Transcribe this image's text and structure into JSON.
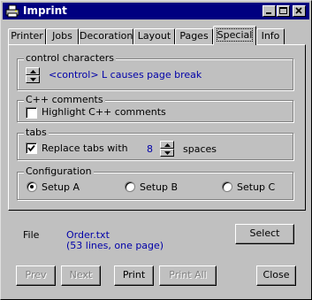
{
  "window": {
    "title": "Imprint",
    "controls": [
      "minimize",
      "maximize",
      "close"
    ]
  },
  "tabs": [
    {
      "label": "Printer",
      "active": false
    },
    {
      "label": "Jobs",
      "active": false
    },
    {
      "label": "Decoration",
      "active": false
    },
    {
      "label": "Layout",
      "active": false
    },
    {
      "label": "Pages",
      "active": false
    },
    {
      "label": "Special",
      "active": true
    },
    {
      "label": "Info",
      "active": false
    }
  ],
  "special": {
    "control_characters": {
      "label": "control characters",
      "value_text": "<control> L causes page break"
    },
    "cpp_comments": {
      "label": "C++ comments",
      "checkbox_label": "Highlight C++ comments",
      "checked": false
    },
    "tabs_group": {
      "label": "tabs",
      "checkbox_label": "Replace tabs with",
      "checked": true,
      "count": "8",
      "suffix": "spaces"
    },
    "configuration": {
      "label": "Configuration",
      "options": [
        "Setup A",
        "Setup B",
        "Setup C"
      ],
      "selected": "Setup A"
    }
  },
  "file": {
    "label": "File",
    "name": "Order.txt",
    "info": "(53 lines, one page)",
    "select_label": "Select"
  },
  "buttons": {
    "prev": "Prev",
    "next": "Next",
    "print": "Print",
    "print_all": "Print All",
    "close": "Close"
  },
  "colors": {
    "titlebar": "#000080",
    "face": "#c0c0c0",
    "value_text": "#0000a8"
  },
  "icons": [
    "printer-icon",
    "minimize-icon",
    "maximize-icon",
    "close-icon",
    "spin-up-icon",
    "spin-down-icon",
    "checkmark-icon"
  ]
}
